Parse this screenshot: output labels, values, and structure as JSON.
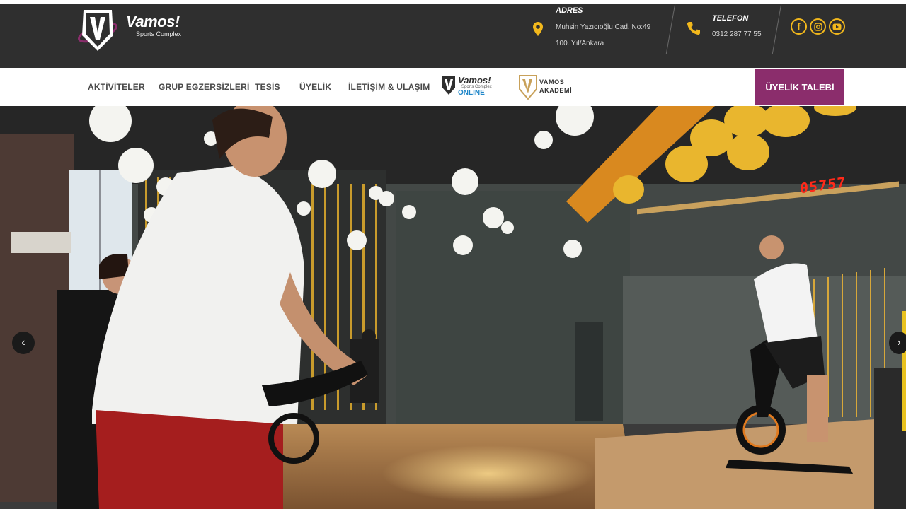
{
  "header": {
    "logo": {
      "name": "Vamos!",
      "subtitle": "Sports Complex"
    },
    "address": {
      "title": "ADRES",
      "line1": "Muhsin Yazıcıoğlu Cad. No:49",
      "line2": "100. Yıl/Ankara"
    },
    "phone": {
      "title": "TELEFON",
      "number": "0312 287 77 55"
    },
    "social": [
      "facebook-icon",
      "instagram-icon",
      "youtube-icon"
    ],
    "colors": {
      "bar": "#2f2f2f",
      "accent": "#f2b81c"
    }
  },
  "nav": {
    "items": [
      "AKTİVİTELER",
      "GRUP EGZERSİZLERİ",
      "TESİS",
      "ÜYELİK",
      "İLETİŞİM & ULAŞIM"
    ],
    "online_logo": {
      "title": "Vamos!",
      "subtitle": "Sports Complex",
      "tag": "ONLINE"
    },
    "akademi_logo": {
      "line1": "VAMOS",
      "line2": "AKADEMİ"
    },
    "cta": "ÜYELİK TALEBİ",
    "colors": {
      "cta": "#8b2d6c"
    }
  },
  "hero": {
    "timer": "05757",
    "prev_icon": "chevron-left-icon",
    "next_icon": "chevron-right-icon"
  }
}
